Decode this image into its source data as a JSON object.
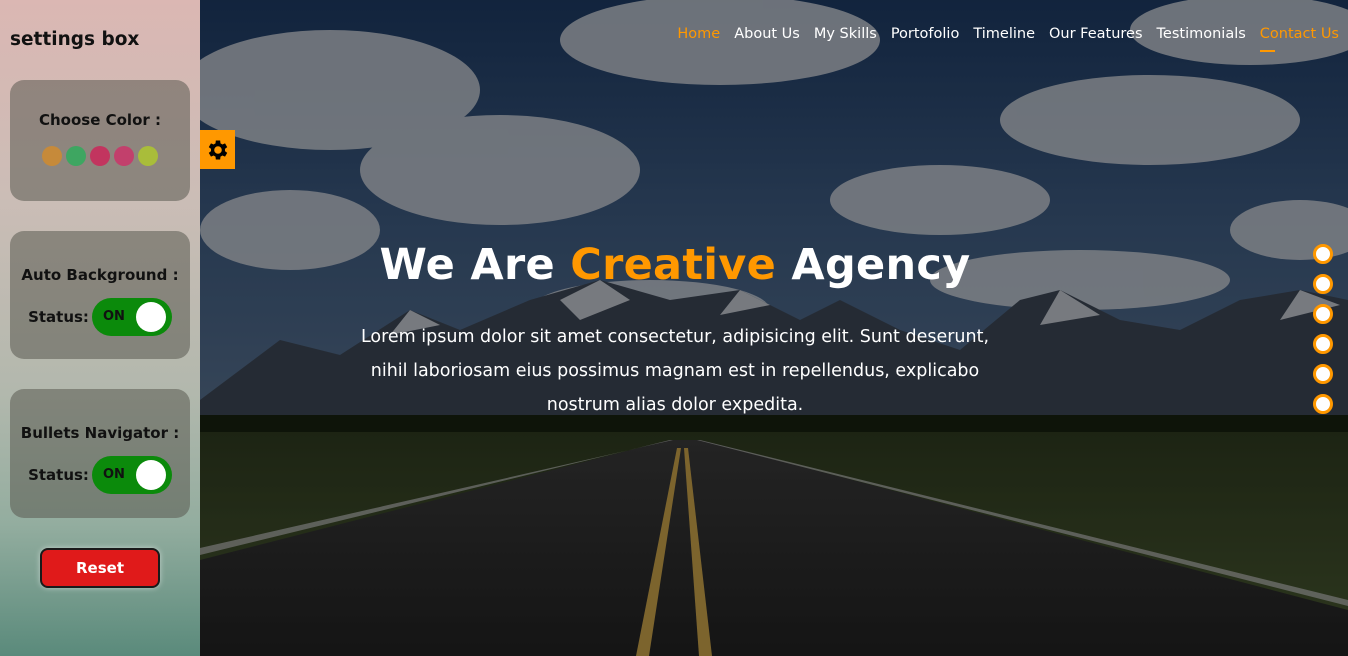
{
  "nav": {
    "items": [
      {
        "label": "Home"
      },
      {
        "label": "About Us"
      },
      {
        "label": "My Skills"
      },
      {
        "label": "Portofolio"
      },
      {
        "label": "Timeline"
      },
      {
        "label": "Our Features"
      },
      {
        "label": "Testimonials"
      },
      {
        "label": "Contact Us"
      }
    ]
  },
  "hero": {
    "title_before": "We Are",
    "title_accent": "Creative",
    "title_after": "Agency",
    "paragraph": "Lorem ipsum dolor sit amet consectetur, adipisicing elit. Sunt deserunt, nihil laboriosam eius possimus magnam est in repellendus, explicabo nostrum alias dolor expedita."
  },
  "settings": {
    "title": "settings box",
    "color_label": "Choose Color :",
    "colors": [
      "#c68a3a",
      "#3ea661",
      "#c2355f",
      "#c2406c",
      "#a9bd3a"
    ],
    "auto_bg_label": "Auto Background :",
    "bullets_label": "Bullets Navigator :",
    "status_label": "Status:",
    "toggle_on": "ON",
    "reset_label": "Reset"
  },
  "bullets_count": 6,
  "colors": {
    "accent": "#ff9800",
    "toggle": "#0b8a0b",
    "reset": "#e01a1a"
  },
  "icons": {
    "settings_toggle": "gear-icon"
  }
}
